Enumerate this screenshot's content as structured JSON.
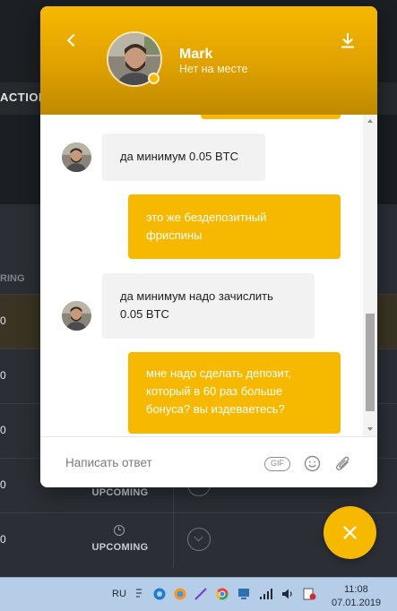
{
  "background": {
    "band_label": "ACTION",
    "column_header": "RING",
    "rows": [
      {
        "value": "0",
        "status": ""
      },
      {
        "value": "0",
        "status": ""
      },
      {
        "value": "0",
        "status": ""
      },
      {
        "value": "0",
        "status": "UPCOMING"
      },
      {
        "value": "0",
        "status": "UPCOMING"
      }
    ]
  },
  "chat": {
    "agent_name": "Mark",
    "agent_status": "Нет на месте",
    "messages": [
      {
        "from": "agent",
        "text": "да минимум 0.05 BTC"
      },
      {
        "from": "user",
        "text": "это же бездепозитный фриспины"
      },
      {
        "from": "agent",
        "text": "да минимум надо зачислить 0.05 BTC"
      },
      {
        "from": "user",
        "text": "мне надо сделать депозит, который в 60 раз больше бонуса? вы издеваетесь?"
      }
    ],
    "composer": {
      "placeholder": "Написать ответ",
      "gif_label": "GIF"
    },
    "icons": [
      "back-icon",
      "download-icon",
      "emoji-icon",
      "paperclip-icon",
      "close-icon"
    ]
  },
  "taskbar": {
    "language": "RU",
    "time": "11:08",
    "date": "07.01.2019"
  },
  "colors": {
    "accent": "#f7b800",
    "agent_bubble": "#f2f2f3",
    "page_bg": "#1f2226"
  }
}
